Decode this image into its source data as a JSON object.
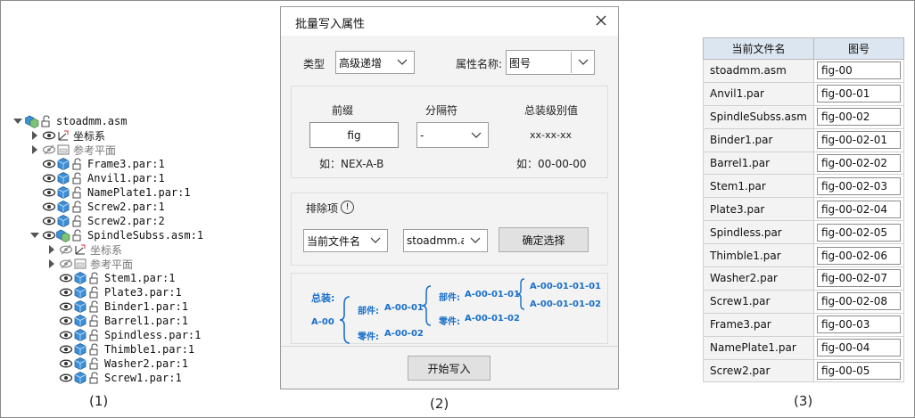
{
  "captions": {
    "panel1": "(1)",
    "panel2": "(2)",
    "panel3": "(3)"
  },
  "tree": {
    "items": [
      {
        "label": "stoadmm.asm",
        "type": "asm"
      },
      {
        "label": "坐标系",
        "type": "coord"
      },
      {
        "label": "参考平面",
        "type": "plane"
      },
      {
        "label": "Frame3.par:1",
        "type": "part"
      },
      {
        "label": "Anvil1.par:1",
        "type": "part"
      },
      {
        "label": "NamePlate1.par:1",
        "type": "part"
      },
      {
        "label": "Screw2.par:1",
        "type": "part"
      },
      {
        "label": "Screw2.par:2",
        "type": "part"
      },
      {
        "label": "SpindleSubss.asm:1",
        "type": "asm"
      },
      {
        "label": "坐标系",
        "type": "coord"
      },
      {
        "label": "参考平面",
        "type": "plane"
      },
      {
        "label": "Stem1.par:1",
        "type": "part"
      },
      {
        "label": "Plate3.par:1",
        "type": "part"
      },
      {
        "label": "Binder1.par:1",
        "type": "part"
      },
      {
        "label": "Barrel1.par:1",
        "type": "part"
      },
      {
        "label": "Spindless.par:1",
        "type": "part"
      },
      {
        "label": "Thimble1.par:1",
        "type": "part"
      },
      {
        "label": "Washer2.par:1",
        "type": "part"
      },
      {
        "label": "Screw1.par:1",
        "type": "part"
      }
    ]
  },
  "dialog": {
    "title": "批量写入属性",
    "type_label": "类型",
    "type_value": "高级递增",
    "prop_label": "属性名称:",
    "prop_value": "图号",
    "prefix_header": "前缀",
    "sep_header": "分隔符",
    "level_header": "总装级别值",
    "prefix_value": "fig",
    "sep_value": "-",
    "level_value": "xx-xx-xx",
    "prefix_example": "如：NEX-A-B",
    "level_example": "如：00-00-00",
    "exclude_label": "排除项",
    "exclude_info": "!",
    "exclude_field": "当前文件名",
    "exclude_value": "stoadmm.as",
    "confirm_button": "确定选择",
    "start_button": "开始写入",
    "example": {
      "total_label": "总装:",
      "root": "A-00",
      "assembly_prefix": "部件:",
      "assembly_value": "A-00-01",
      "sub_assembly_prefix": "部件:",
      "sub_assembly_value": "A-00-01-01",
      "sub_children": [
        "A-00-01-01-01",
        "A-00-01-01-02"
      ],
      "sub_part_prefix": "零件:",
      "sub_part_value": "A-00-01-02",
      "part_prefix": "零件:",
      "part_value": "A-00-02"
    }
  },
  "table": {
    "headers": [
      "当前文件名",
      "图号"
    ],
    "rows": [
      [
        "stoadmm.asm",
        "fig-00"
      ],
      [
        "Anvil1.par",
        "fig-00-01"
      ],
      [
        "SpindleSubss.asm",
        "fig-00-02"
      ],
      [
        "Binder1.par",
        "fig-00-02-01"
      ],
      [
        "Barrel1.par",
        "fig-00-02-02"
      ],
      [
        "Stem1.par",
        "fig-00-02-03"
      ],
      [
        "Plate3.par",
        "fig-00-02-04"
      ],
      [
        "Spindless.par",
        "fig-00-02-05"
      ],
      [
        "Thimble1.par",
        "fig-00-02-06"
      ],
      [
        "Washer2.par",
        "fig-00-02-07"
      ],
      [
        "Screw1.par",
        "fig-00-02-08"
      ],
      [
        "Frame3.par",
        "fig-00-03"
      ],
      [
        "NamePlate1.par",
        "fig-00-04"
      ],
      [
        "Screw2.par",
        "fig-00-05"
      ]
    ]
  },
  "colors": {
    "accent_blue": "#1a6fc9",
    "part_blue": "#3d8fd6",
    "header_bg": "#dce6f1",
    "dialog_bg": "#f3f3f3"
  }
}
